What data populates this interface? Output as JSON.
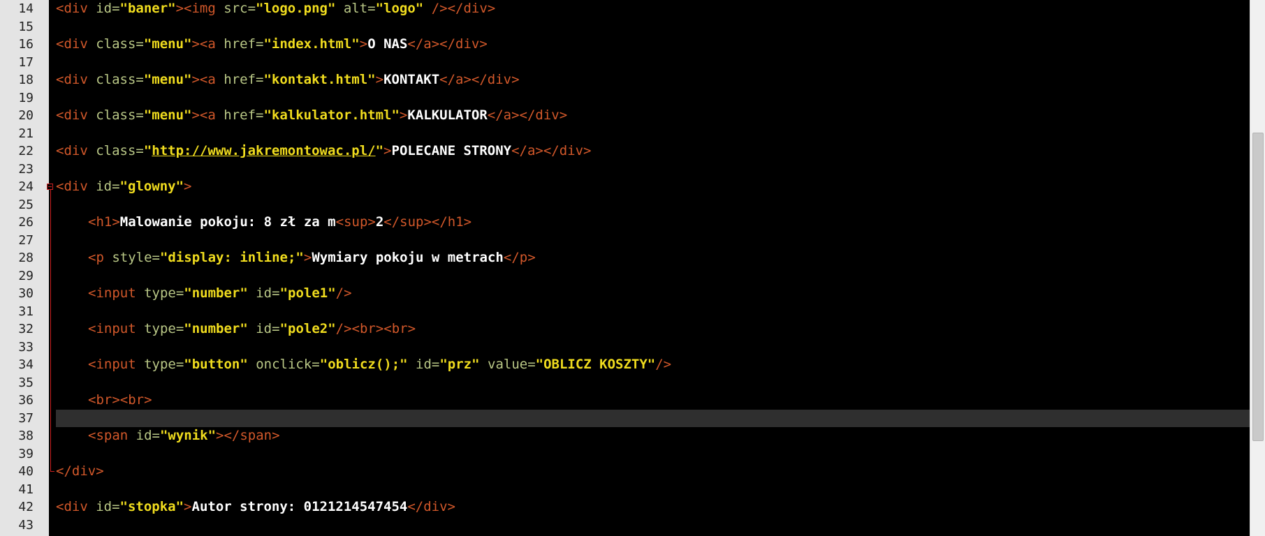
{
  "editor": {
    "theme_colors": {
      "tag": "#d2582a",
      "attr": "#b9c786",
      "string": "#f0dc1e",
      "text": "#ffffff",
      "background": "#000000"
    },
    "current_line": 37,
    "lines": [
      {
        "n": "14",
        "indent": 0,
        "tokens": [
          [
            "t",
            "<div "
          ],
          [
            "a",
            "id="
          ],
          [
            "s",
            "\"baner\""
          ],
          [
            "t",
            "><img "
          ],
          [
            "a",
            "src="
          ],
          [
            "s",
            "\"logo.png\""
          ],
          [
            "a",
            " alt="
          ],
          [
            "s",
            "\"logo\""
          ],
          [
            "t",
            " /></div>"
          ]
        ]
      },
      {
        "n": "15",
        "indent": 0,
        "tokens": []
      },
      {
        "n": "16",
        "indent": 0,
        "tokens": [
          [
            "t",
            "<div "
          ],
          [
            "a",
            "class="
          ],
          [
            "s",
            "\"menu\""
          ],
          [
            "t",
            "><a "
          ],
          [
            "a",
            "href="
          ],
          [
            "s",
            "\"index.html\""
          ],
          [
            "t",
            ">"
          ],
          [
            "x",
            "O NAS"
          ],
          [
            "t",
            "</a></div>"
          ]
        ]
      },
      {
        "n": "17",
        "indent": 0,
        "tokens": []
      },
      {
        "n": "18",
        "indent": 0,
        "tokens": [
          [
            "t",
            "<div "
          ],
          [
            "a",
            "class="
          ],
          [
            "s",
            "\"menu\""
          ],
          [
            "t",
            "><a "
          ],
          [
            "a",
            "href="
          ],
          [
            "s",
            "\"kontakt.html\""
          ],
          [
            "t",
            ">"
          ],
          [
            "x",
            "KONTAKT"
          ],
          [
            "t",
            "</a></div>"
          ]
        ]
      },
      {
        "n": "19",
        "indent": 0,
        "tokens": []
      },
      {
        "n": "20",
        "indent": 0,
        "tokens": [
          [
            "t",
            "<div "
          ],
          [
            "a",
            "class="
          ],
          [
            "s",
            "\"menu\""
          ],
          [
            "t",
            "><a "
          ],
          [
            "a",
            "href="
          ],
          [
            "s",
            "\"kalkulator.html\""
          ],
          [
            "t",
            ">"
          ],
          [
            "x",
            "KALKULATOR"
          ],
          [
            "t",
            "</a></div>"
          ]
        ]
      },
      {
        "n": "21",
        "indent": 0,
        "tokens": []
      },
      {
        "n": "22",
        "indent": 0,
        "tokens": [
          [
            "t",
            "<div "
          ],
          [
            "a",
            "class="
          ],
          [
            "s",
            "\""
          ],
          [
            "su",
            "http://www.jakremontowac.pl/"
          ],
          [
            "s",
            "\""
          ],
          [
            "t",
            ">"
          ],
          [
            "x",
            "POLECANE STRONY"
          ],
          [
            "t",
            "</a></div>"
          ]
        ]
      },
      {
        "n": "23",
        "indent": 0,
        "tokens": []
      },
      {
        "n": "24",
        "indent": 0,
        "tokens": [
          [
            "t",
            "<div "
          ],
          [
            "a",
            "id="
          ],
          [
            "s",
            "\"glowny\""
          ],
          [
            "t",
            ">"
          ]
        ]
      },
      {
        "n": "25",
        "indent": 0,
        "tokens": []
      },
      {
        "n": "26",
        "indent": 1,
        "tokens": [
          [
            "t",
            "<h1>"
          ],
          [
            "x",
            "Malowanie pokoju: 8 zł za m"
          ],
          [
            "t",
            "<sup>"
          ],
          [
            "x",
            "2"
          ],
          [
            "t",
            "</sup></h1>"
          ]
        ]
      },
      {
        "n": "27",
        "indent": 0,
        "tokens": []
      },
      {
        "n": "28",
        "indent": 1,
        "tokens": [
          [
            "t",
            "<p "
          ],
          [
            "a",
            "style="
          ],
          [
            "s",
            "\"display: inline;\""
          ],
          [
            "t",
            ">"
          ],
          [
            "x",
            "Wymiary pokoju w metrach"
          ],
          [
            "t",
            "</p>"
          ]
        ]
      },
      {
        "n": "29",
        "indent": 0,
        "tokens": []
      },
      {
        "n": "30",
        "indent": 1,
        "tokens": [
          [
            "t",
            "<input "
          ],
          [
            "a",
            "type="
          ],
          [
            "s",
            "\"number\""
          ],
          [
            "a",
            " id="
          ],
          [
            "s",
            "\"pole1\""
          ],
          [
            "t",
            "/>"
          ]
        ]
      },
      {
        "n": "31",
        "indent": 0,
        "tokens": []
      },
      {
        "n": "32",
        "indent": 1,
        "tokens": [
          [
            "t",
            "<input "
          ],
          [
            "a",
            "type="
          ],
          [
            "s",
            "\"number\""
          ],
          [
            "a",
            " id="
          ],
          [
            "s",
            "\"pole2\""
          ],
          [
            "t",
            "/><br><br>"
          ]
        ]
      },
      {
        "n": "33",
        "indent": 0,
        "tokens": []
      },
      {
        "n": "34",
        "indent": 1,
        "tokens": [
          [
            "t",
            "<input "
          ],
          [
            "a",
            "type="
          ],
          [
            "s",
            "\"button\""
          ],
          [
            "a",
            " onclick="
          ],
          [
            "s",
            "\"oblicz();\""
          ],
          [
            "a",
            " id="
          ],
          [
            "s",
            "\"prz\""
          ],
          [
            "a",
            " value="
          ],
          [
            "s",
            "\"OBLICZ KOSZTY\""
          ],
          [
            "t",
            "/>"
          ]
        ]
      },
      {
        "n": "35",
        "indent": 0,
        "tokens": []
      },
      {
        "n": "36",
        "indent": 1,
        "tokens": [
          [
            "t",
            "<br><br>"
          ]
        ]
      },
      {
        "n": "37",
        "indent": 0,
        "tokens": []
      },
      {
        "n": "38",
        "indent": 1,
        "tokens": [
          [
            "t",
            "<span "
          ],
          [
            "a",
            "id="
          ],
          [
            "s",
            "\"wynik\""
          ],
          [
            "t",
            "></span>"
          ]
        ]
      },
      {
        "n": "39",
        "indent": 0,
        "tokens": []
      },
      {
        "n": "40",
        "indent": 0,
        "tokens": [
          [
            "t",
            "</div>"
          ]
        ]
      },
      {
        "n": "41",
        "indent": 0,
        "tokens": []
      },
      {
        "n": "42",
        "indent": 0,
        "tokens": [
          [
            "t",
            "<div "
          ],
          [
            "a",
            "id="
          ],
          [
            "s",
            "\"stopka\""
          ],
          [
            "t",
            ">"
          ],
          [
            "x",
            "Autor strony: 0121214547454"
          ],
          [
            "t",
            "</div>"
          ]
        ]
      },
      {
        "n": "43",
        "indent": 0,
        "tokens": []
      }
    ]
  }
}
